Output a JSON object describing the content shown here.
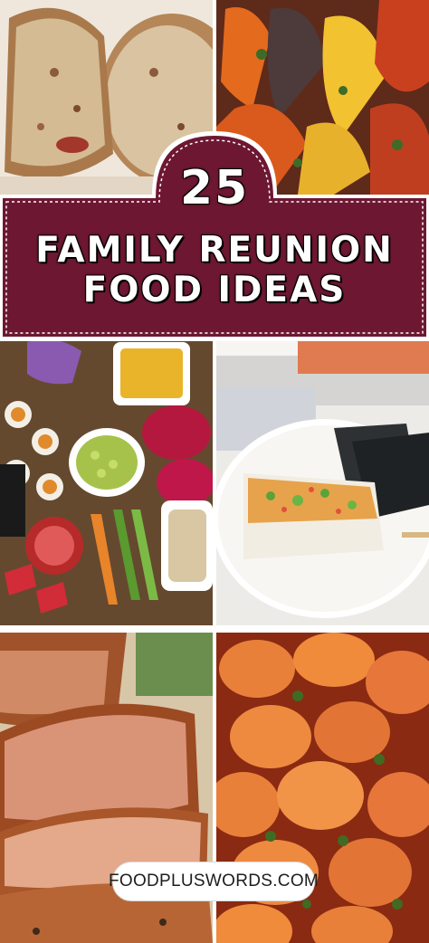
{
  "banner": {
    "number": "25",
    "line1": "FAMILY REUNION",
    "line2": "FOOD IDEAS",
    "background_color": "#6e1732",
    "border_color": "#ffffff"
  },
  "website": {
    "label": "FOODPLUSWORDS.COM"
  },
  "photos": [
    {
      "subject": "sliced bread"
    },
    {
      "subject": "ratatouille"
    },
    {
      "subject": "charcuterie board with sushi and fruit"
    },
    {
      "subject": "sushi bake with nori"
    },
    {
      "subject": "sliced glazed ham"
    },
    {
      "subject": "cajun shrimp"
    }
  ]
}
